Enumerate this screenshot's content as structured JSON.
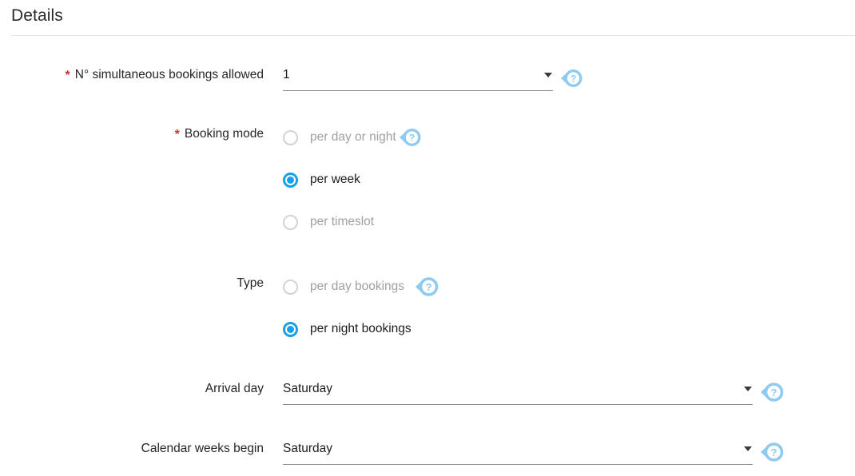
{
  "section": {
    "title": "Details"
  },
  "colors": {
    "accent": "#18a0e8",
    "help_bubble": "#8fcbf0",
    "required_asterisk": "#c0392b",
    "divider": "#e4e4e4",
    "underline": "#8a8a8a",
    "disabled_text": "#a0a0a0"
  },
  "fields": {
    "simultaneous_bookings": {
      "label": "N° simultaneous bookings allowed",
      "required_marker": "*",
      "value": "1",
      "caret_icon": "chevron-down-icon",
      "help_icon": "help-question-icon"
    },
    "booking_mode": {
      "label": "Booking mode",
      "required_marker": "*",
      "options": [
        {
          "label": "per day or night",
          "selected": false,
          "disabled": true,
          "help_icon": "help-question-icon"
        },
        {
          "label": "per week",
          "selected": true,
          "disabled": false,
          "help_icon": null
        },
        {
          "label": "per timeslot",
          "selected": false,
          "disabled": true,
          "help_icon": null
        }
      ]
    },
    "type": {
      "label": "Type",
      "required_marker": "",
      "options": [
        {
          "label": "per day bookings",
          "selected": false,
          "disabled": true,
          "help_icon": "help-question-icon"
        },
        {
          "label": "per night bookings",
          "selected": true,
          "disabled": false,
          "help_icon": null
        }
      ]
    },
    "arrival_day": {
      "label": "Arrival day",
      "required_marker": "",
      "value": "Saturday",
      "caret_icon": "chevron-down-icon",
      "help_icon": "help-question-icon"
    },
    "calendar_weeks_begin": {
      "label": "Calendar weeks begin",
      "required_marker": "",
      "value": "Saturday",
      "caret_icon": "chevron-down-icon",
      "help_icon": "help-question-icon"
    }
  }
}
